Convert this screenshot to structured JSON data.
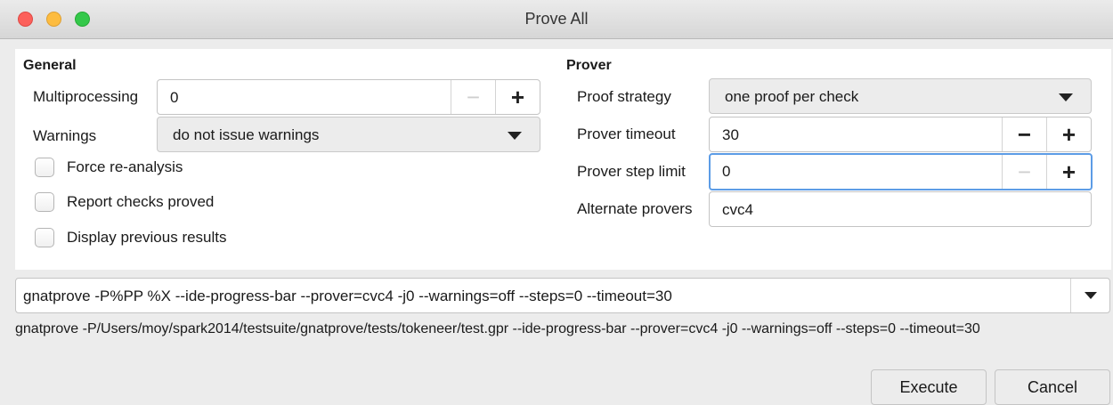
{
  "window": {
    "title": "Prove All"
  },
  "general": {
    "title": "General",
    "multiprocessing": {
      "label": "Multiprocessing",
      "value": "0",
      "decrement": "−",
      "increment": "+"
    },
    "warnings": {
      "label": "Warnings",
      "value": "do not issue warnings"
    },
    "checkboxes": [
      {
        "label": "Force re-analysis",
        "checked": false
      },
      {
        "label": "Report checks proved",
        "checked": false
      },
      {
        "label": "Display previous results",
        "checked": false
      }
    ]
  },
  "prover": {
    "title": "Prover",
    "proof_strategy": {
      "label": "Proof strategy",
      "value": "one proof per check"
    },
    "timeout": {
      "label": "Prover timeout",
      "value": "30",
      "decrement": "−",
      "increment": "+"
    },
    "step_limit": {
      "label": "Prover step limit",
      "value": "0",
      "decrement": "−",
      "increment": "+"
    },
    "alternate": {
      "label": "Alternate provers",
      "value": "cvc4"
    }
  },
  "command": {
    "template": "gnatprove -P%PP %X --ide-progress-bar --prover=cvc4 -j0 --warnings=off --steps=0 --timeout=30",
    "expanded": "gnatprove -P/Users/moy/spark2014/testsuite/gnatprove/tests/tokeneer/test.gpr --ide-progress-bar --prover=cvc4 -j0 --warnings=off --steps=0 --timeout=30"
  },
  "buttons": {
    "execute": "Execute",
    "cancel": "Cancel"
  }
}
